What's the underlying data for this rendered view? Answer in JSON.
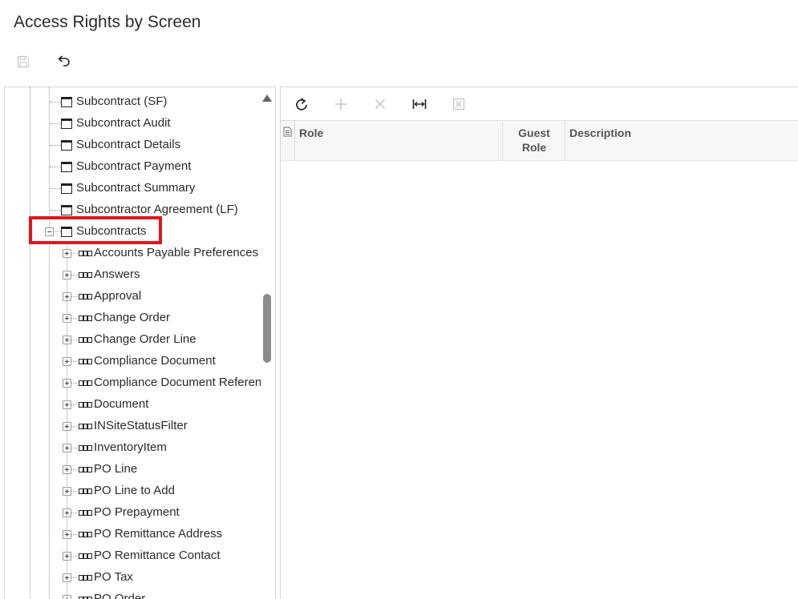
{
  "page": {
    "title": "Access Rights by Screen"
  },
  "top_toolbar": {
    "save_icon": "save-icon",
    "undo_icon": "undo-icon"
  },
  "tree": {
    "nodes": [
      {
        "label": "Subcontract (SF)",
        "kind": "screen"
      },
      {
        "label": "Subcontract Audit",
        "kind": "screen"
      },
      {
        "label": "Subcontract Details",
        "kind": "screen"
      },
      {
        "label": "Subcontract Payment",
        "kind": "screen"
      },
      {
        "label": "Subcontract Summary",
        "kind": "screen"
      },
      {
        "label": "Subcontractor Agreement (LF)",
        "kind": "screen"
      },
      {
        "label": "Subcontracts",
        "kind": "screen",
        "expanded": true,
        "selected": true
      },
      {
        "label": "Accounts Payable Preferences",
        "kind": "table"
      },
      {
        "label": "Answers",
        "kind": "table"
      },
      {
        "label": "Approval",
        "kind": "table"
      },
      {
        "label": "Change Order",
        "kind": "table"
      },
      {
        "label": "Change Order Line",
        "kind": "table"
      },
      {
        "label": "Compliance Document",
        "kind": "table"
      },
      {
        "label": "Compliance Document Reference",
        "kind": "table"
      },
      {
        "label": "Document",
        "kind": "table"
      },
      {
        "label": "INSiteStatusFilter",
        "kind": "table"
      },
      {
        "label": "InventoryItem",
        "kind": "table"
      },
      {
        "label": "PO Line",
        "kind": "table"
      },
      {
        "label": "PO Line to Add",
        "kind": "table"
      },
      {
        "label": "PO Prepayment",
        "kind": "table"
      },
      {
        "label": "PO Remittance Address",
        "kind": "table"
      },
      {
        "label": "PO Remittance Contact",
        "kind": "table"
      },
      {
        "label": "PO Tax",
        "kind": "table"
      },
      {
        "label": "PO Order",
        "kind": "table"
      }
    ]
  },
  "grid": {
    "toolbar": {
      "refresh_icon": "refresh-icon",
      "add_icon": "add-icon",
      "delete_icon": "delete-icon",
      "fit_columns_icon": "fit-columns-icon",
      "export_excel_icon": "export-excel-icon"
    },
    "columns": {
      "role": "Role",
      "guest_role_line1": "Guest",
      "guest_role_line2": "Role",
      "description": "Description"
    },
    "rows": []
  }
}
